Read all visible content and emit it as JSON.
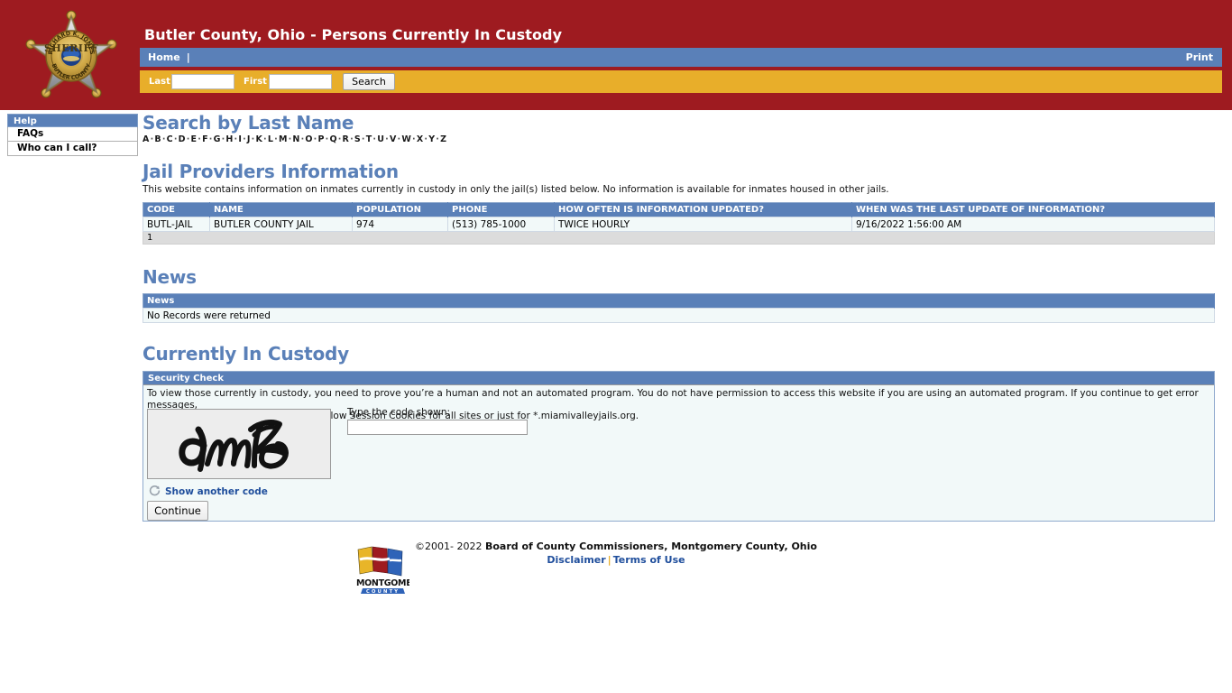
{
  "header": {
    "title": "Butler County, Ohio - Persons Currently In Custody",
    "badge_alt": "Richard K. Jones Sheriff Butler County badge",
    "brand_red": "#9E1B20",
    "nav_blue": "#5A80B8",
    "nav_gold": "#E8AE2A",
    "nav": {
      "home_label": "Home",
      "separator": "|",
      "print_label": "Print"
    },
    "search": {
      "last_label": "Last",
      "last_value": "",
      "first_label": "First",
      "first_value": "",
      "button_label": "Search"
    }
  },
  "sidebar": {
    "header_label": "Help",
    "items": [
      {
        "label": "FAQs"
      },
      {
        "label": "Who can I call?"
      }
    ]
  },
  "main": {
    "search_by_last_name": {
      "heading": "Search by Last Name",
      "letters": [
        "A",
        "B",
        "C",
        "D",
        "E",
        "F",
        "G",
        "H",
        "I",
        "J",
        "K",
        "L",
        "M",
        "N",
        "O",
        "P",
        "Q",
        "R",
        "S",
        "T",
        "U",
        "V",
        "W",
        "X",
        "Y",
        "Z"
      ]
    },
    "jail_providers": {
      "heading": "Jail Providers Information",
      "blurb": "This website contains information on inmates currently in custody in only the jail(s) listed below. No information is available for inmates housed in other jails.",
      "columns": [
        "CODE",
        "NAME",
        "POPULATION",
        "PHONE",
        "HOW OFTEN IS INFORMATION UPDATED?",
        "WHEN WAS THE LAST UPDATE OF INFORMATION?"
      ],
      "rows": [
        [
          "BUTL-JAIL",
          "BUTLER COUNTY JAIL",
          "974",
          "(513) 785-1000",
          "TWICE HOURLY",
          "9/16/2022 1:56:00 AM"
        ]
      ],
      "pager": "1"
    },
    "news": {
      "heading": "News",
      "columns": [
        "News"
      ],
      "empty_message": "No Records were returned"
    },
    "custody": {
      "heading": "Currently In Custody",
      "panel_title": "Security Check",
      "paragraph_line1": "To view those currently in custody, you need to prove you’re a human and not an automated program. You do not have permission to access this website if you are using an automated program. If you continue to get error messages,",
      "paragraph_line2": "please ensure your browser is set to allow Session Cookies for all sites or just for *.miamivalleyjails.org.",
      "captcha_text": "9mibe",
      "refresh_label": "Show another code",
      "code_label": "Type the code shown:",
      "code_value": "",
      "continue_label": "Continue"
    }
  },
  "footer": {
    "copyright_symbol": "©2001- 2022 ",
    "copyright_owner": "Board of County Commissioners, Montgomery County, Ohio",
    "disclaimer_label": "Disclaimer",
    "pipe": "|",
    "terms_label": "Terms of Use",
    "logo_text_top": "MONTGOMERY",
    "logo_text_bottom": "C O U N T Y"
  }
}
